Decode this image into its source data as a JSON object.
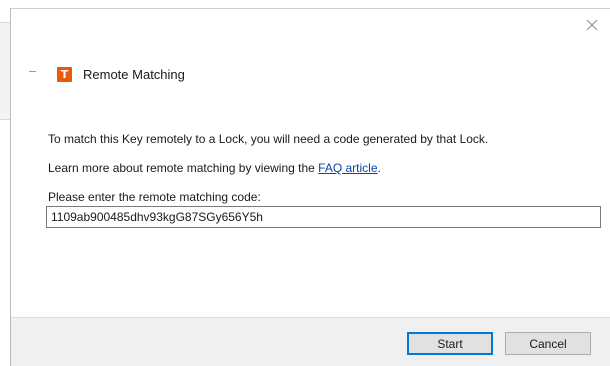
{
  "dialog": {
    "title": "Remote Matching",
    "app_icon_letter": "T",
    "accent_color": "#e8590c",
    "close_icon": "close-icon"
  },
  "body": {
    "line1": "To match this Key remotely to a Lock, you will need a code generated by that Lock.",
    "line2_prefix": "Learn more about remote matching by viewing the ",
    "line2_link": "FAQ article",
    "line2_suffix": ".",
    "prompt": "Please enter the remote matching code:",
    "code_value": "1109ab900485dhv93kgG87SGy656Y5h"
  },
  "buttons": {
    "start_label": "Start",
    "cancel_label": "Cancel"
  }
}
